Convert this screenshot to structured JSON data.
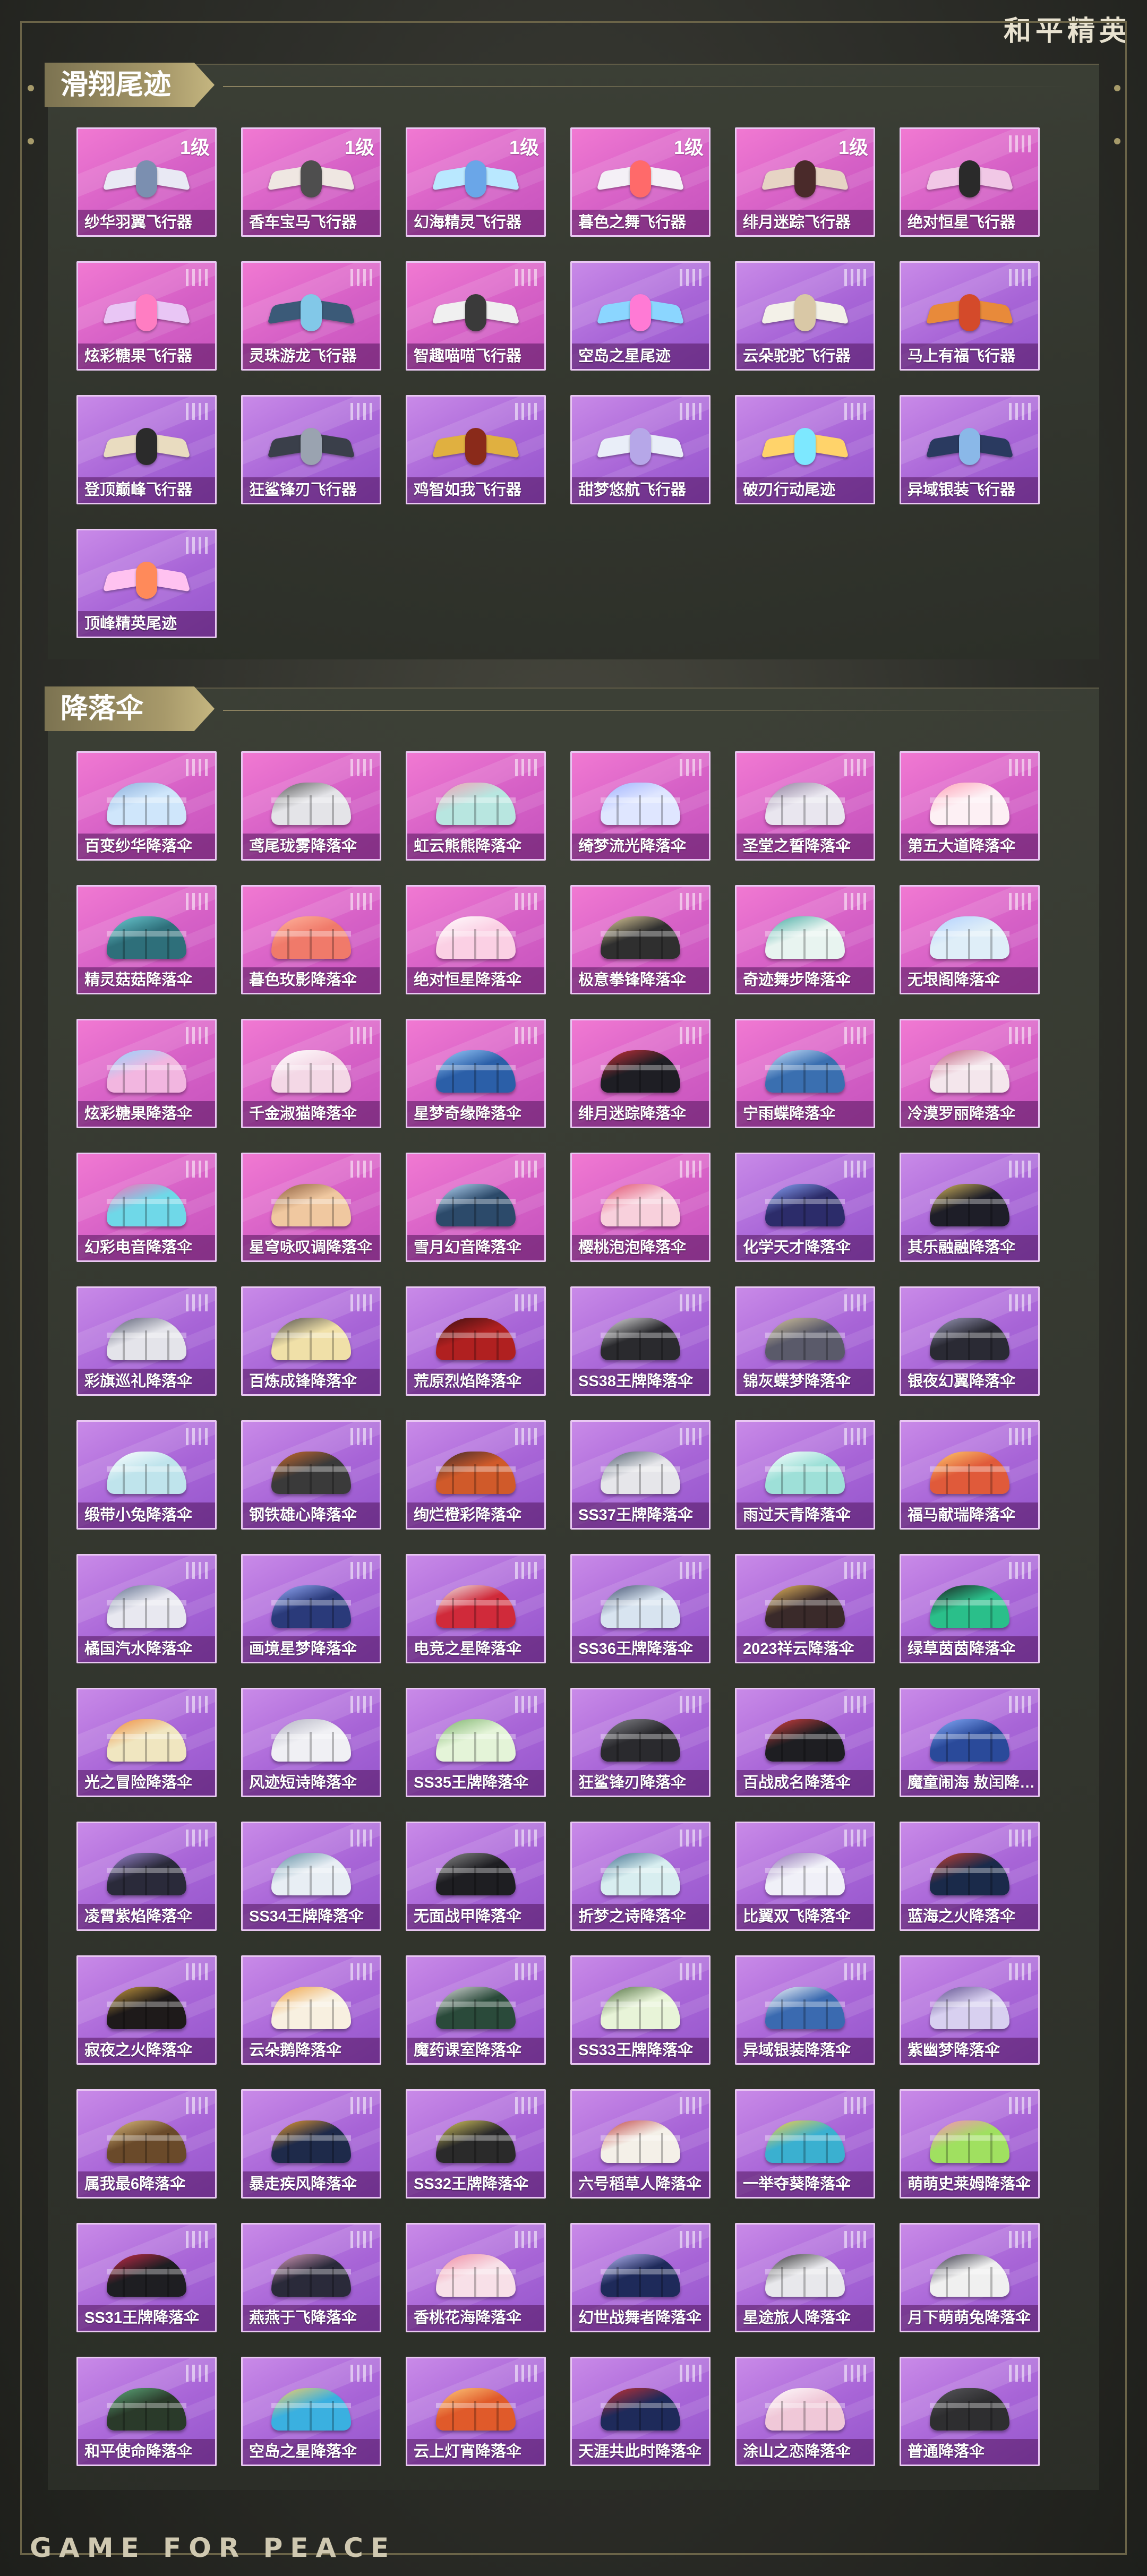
{
  "brand": {
    "logo_text": "和平精英",
    "footer_text": "GAME FOR PEACE"
  },
  "sections": [
    {
      "title": "滑翔尾迹",
      "items": [
        {
          "name": "纱华羽翼飞行器",
          "level": "1级",
          "style": "pink",
          "color": "#e9e9f4",
          "accent": "#7b8fb0"
        },
        {
          "name": "香车宝马飞行器",
          "level": "1级",
          "style": "pink",
          "color": "#efe7e2",
          "accent": "#4e4e4e"
        },
        {
          "name": "幻海精灵飞行器",
          "level": "1级",
          "style": "pink",
          "color": "#b9e8ff",
          "accent": "#6aa6e8"
        },
        {
          "name": "暮色之舞飞行器",
          "level": "1级",
          "style": "pink",
          "color": "#f4f0f6",
          "accent": "#ff6a6a"
        },
        {
          "name": "绯月迷踪飞行器",
          "level": "1级",
          "style": "pink",
          "color": "#e6d4c4",
          "accent": "#4a2a2a"
        },
        {
          "name": "绝对恒星飞行器",
          "level": "",
          "style": "pink",
          "color": "#f1c8e6",
          "accent": "#2a2a2a"
        },
        {
          "name": "炫彩糖果飞行器",
          "level": "",
          "style": "pink",
          "color": "#e9c6f5",
          "accent": "#ff7dc2"
        },
        {
          "name": "灵珠游龙飞行器",
          "level": "",
          "style": "pink",
          "color": "#3b5a78",
          "accent": "#82c8e8"
        },
        {
          "name": "智趣喵喵飞行器",
          "level": "",
          "style": "pink",
          "color": "#f0f0f0",
          "accent": "#3a3a3a"
        },
        {
          "name": "空岛之星尾迹",
          "level": "",
          "style": "purple",
          "color": "#8bd6ff",
          "accent": "#ff7ad5"
        },
        {
          "name": "云朵驼驼飞行器",
          "level": "",
          "style": "purple",
          "color": "#f3f1e8",
          "accent": "#d9c8a6"
        },
        {
          "name": "马上有福飞行器",
          "level": "",
          "style": "purple",
          "color": "#e88a3a",
          "accent": "#d44a2a"
        },
        {
          "name": "登顶巅峰飞行器",
          "level": "",
          "style": "purple",
          "color": "#e9dcc0",
          "accent": "#2b2b2b"
        },
        {
          "name": "狂鲨锋刃飞行器",
          "level": "",
          "style": "purple",
          "color": "#3a3f4a",
          "accent": "#9aa3b0"
        },
        {
          "name": "鸡智如我飞行器",
          "level": "",
          "style": "purple",
          "color": "#e0b040",
          "accent": "#8a2a1a"
        },
        {
          "name": "甜梦悠航飞行器",
          "level": "",
          "style": "purple",
          "color": "#e9eef8",
          "accent": "#b6a7e8"
        },
        {
          "name": "破刃行动尾迹",
          "level": "",
          "style": "purple",
          "color": "#ffd36a",
          "accent": "#7de8ff"
        },
        {
          "name": "异域银装飞行器",
          "level": "",
          "style": "purple",
          "color": "#2a3a60",
          "accent": "#8ab8e8"
        },
        {
          "name": "顶峰精英尾迹",
          "level": "",
          "style": "purple",
          "color": "#ffc2f0",
          "accent": "#ff8a5a"
        }
      ]
    },
    {
      "title": "降落伞",
      "items": [
        {
          "name": "百变纱华降落伞",
          "level": "",
          "style": "pink",
          "color": "#cfe6fb",
          "accent": "#8aaedb"
        },
        {
          "name": "鸢尾珑雾降落伞",
          "level": "",
          "style": "pink",
          "color": "#e4e4e8",
          "accent": "#555555"
        },
        {
          "name": "虹云熊熊降落伞",
          "level": "",
          "style": "pink",
          "color": "#b8e6e0",
          "accent": "#f4a0b4"
        },
        {
          "name": "绮梦流光降落伞",
          "level": "",
          "style": "pink",
          "color": "#dfe6ff",
          "accent": "#9fb2ff"
        },
        {
          "name": "圣堂之誓降落伞",
          "level": "",
          "style": "pink",
          "color": "#e9e6ef",
          "accent": "#8b7a9a"
        },
        {
          "name": "第五大道降落伞",
          "level": "",
          "style": "pink",
          "color": "#fdf0f4",
          "accent": "#ff9fb5"
        },
        {
          "name": "精灵菇菇降落伞",
          "level": "",
          "style": "pink",
          "color": "#2e6f7a",
          "accent": "#6fd0d8"
        },
        {
          "name": "暮色玫影降落伞",
          "level": "",
          "style": "pink",
          "color": "#f07a6a",
          "accent": "#ffb7a0"
        },
        {
          "name": "绝对恒星降落伞",
          "level": "",
          "style": "pink",
          "color": "#fbd0e4",
          "accent": "#ffffff"
        },
        {
          "name": "极意拳锋降落伞",
          "level": "",
          "style": "pink",
          "color": "#2f2f2f",
          "accent": "#e9d6a0"
        },
        {
          "name": "奇迹舞步降落伞",
          "level": "",
          "style": "pink",
          "color": "#e8f4f0",
          "accent": "#3fa8a0"
        },
        {
          "name": "无垠阁降落伞",
          "level": "",
          "style": "pink",
          "color": "#dfeef8",
          "accent": "#b0d0ff"
        },
        {
          "name": "炫彩糖果降落伞",
          "level": "",
          "style": "pink",
          "color": "#f2b6e0",
          "accent": "#8ed6ff"
        },
        {
          "name": "千金淑猫降落伞",
          "level": "",
          "style": "pink",
          "color": "#f4d8e6",
          "accent": "#ffffff"
        },
        {
          "name": "星梦奇缘降落伞",
          "level": "",
          "style": "pink",
          "color": "#2b5fa8",
          "accent": "#9fd0ff"
        },
        {
          "name": "绯月迷踪降落伞",
          "level": "",
          "style": "pink",
          "color": "#1e1e24",
          "accent": "#d2303a"
        },
        {
          "name": "宁雨蝶降落伞",
          "level": "",
          "style": "pink",
          "color": "#3a6fb0",
          "accent": "#cfe6ff"
        },
        {
          "name": "冷漠罗丽降落伞",
          "level": "",
          "style": "pink",
          "color": "#f4e6ec",
          "accent": "#c05a7a"
        },
        {
          "name": "幻彩电音降落伞",
          "level": "",
          "style": "pink",
          "color": "#6fd8e8",
          "accent": "#ff6ab8"
        },
        {
          "name": "星穹咏叹调降落伞",
          "level": "",
          "style": "pink",
          "color": "#f0c8a0",
          "accent": "#8a5a3a"
        },
        {
          "name": "雪月幻音降落伞",
          "level": "",
          "style": "pink",
          "color": "#2c4a6a",
          "accent": "#bfe0ff"
        },
        {
          "name": "樱桃泡泡降落伞",
          "level": "",
          "style": "pink",
          "color": "#f8d0dc",
          "accent": "#e04a6a"
        },
        {
          "name": "化学天才降落伞",
          "level": "",
          "style": "purple",
          "color": "#2c2c6a",
          "accent": "#8fa8ff"
        },
        {
          "name": "其乐融融降落伞",
          "level": "",
          "style": "purple",
          "color": "#1e1e28",
          "accent": "#e0c060"
        },
        {
          "name": "彩旗巡礼降落伞",
          "level": "",
          "style": "purple",
          "color": "#e4e4ea",
          "accent": "#555a70"
        },
        {
          "name": "百炼成锋降落伞",
          "level": "",
          "style": "purple",
          "color": "#f0e0a8",
          "accent": "#4a4a4a"
        },
        {
          "name": "荒原烈焰降落伞",
          "level": "",
          "style": "purple",
          "color": "#b02020",
          "accent": "#3a1010"
        },
        {
          "name": "SS38王牌降落伞",
          "level": "",
          "style": "purple",
          "color": "#2a2a2e",
          "accent": "#e8e8e8"
        },
        {
          "name": "锦灰蝶梦降落伞",
          "level": "",
          "style": "purple",
          "color": "#5a5a6a",
          "accent": "#d8c8a0"
        },
        {
          "name": "银夜幻翼降落伞",
          "level": "",
          "style": "purple",
          "color": "#2a2a34",
          "accent": "#a0a0c0"
        },
        {
          "name": "缎带小兔降落伞",
          "level": "",
          "style": "purple",
          "color": "#bfe4ec",
          "accent": "#ffffff"
        },
        {
          "name": "钢铁雄心降落伞",
          "level": "",
          "style": "purple",
          "color": "#3a3a3a",
          "accent": "#d06a2a"
        },
        {
          "name": "绚烂橙彩降落伞",
          "level": "",
          "style": "purple",
          "color": "#d05a2a",
          "accent": "#3a2a2a"
        },
        {
          "name": "SS37王牌降落伞",
          "level": "",
          "style": "purple",
          "color": "#e6e6ea",
          "accent": "#4a5a6a"
        },
        {
          "name": "雨过天青降落伞",
          "level": "",
          "style": "purple",
          "color": "#9ee0d8",
          "accent": "#ffffff"
        },
        {
          "name": "福马献瑞降落伞",
          "level": "",
          "style": "purple",
          "color": "#e05a3a",
          "accent": "#ffd070"
        },
        {
          "name": "橘国汽水降落伞",
          "level": "",
          "style": "purple",
          "color": "#e8e8f0",
          "accent": "#5a6a8a"
        },
        {
          "name": "画境星梦降落伞",
          "level": "",
          "style": "purple",
          "color": "#2a3a7a",
          "accent": "#9ab0ff"
        },
        {
          "name": "电竞之星降落伞",
          "level": "",
          "style": "purple",
          "color": "#d02a3a",
          "accent": "#f0f0f0"
        },
        {
          "name": "SS36王牌降落伞",
          "level": "",
          "style": "purple",
          "color": "#d8e4f0",
          "accent": "#3a4a6a"
        },
        {
          "name": "2023祥云降落伞",
          "level": "",
          "style": "purple",
          "color": "#3a2a2a",
          "accent": "#f0c060"
        },
        {
          "name": "绿草茵茵降落伞",
          "level": "",
          "style": "purple",
          "color": "#2abf8a",
          "accent": "#1a1a1a"
        },
        {
          "name": "光之冒险降落伞",
          "level": "",
          "style": "purple",
          "color": "#f0e6c0",
          "accent": "#f08a3a"
        },
        {
          "name": "风迹短诗降落伞",
          "level": "",
          "style": "purple",
          "color": "#f0f0f4",
          "accent": "#b0b0c0"
        },
        {
          "name": "SS35王牌降落伞",
          "level": "",
          "style": "purple",
          "color": "#e4f4d8",
          "accent": "#7ab06a"
        },
        {
          "name": "狂鲨锋刃降落伞",
          "level": "",
          "style": "purple",
          "color": "#2a2a2e",
          "accent": "#8a8a90"
        },
        {
          "name": "百战成名降落伞",
          "level": "",
          "style": "purple",
          "color": "#1e1e22",
          "accent": "#e04040"
        },
        {
          "name": "魔童闹海 敖闰降落伞",
          "level": "",
          "style": "purple",
          "color": "#2a4a9a",
          "accent": "#8ab0ff"
        },
        {
          "name": "凌霄紫焰降落伞",
          "level": "",
          "style": "purple",
          "color": "#2a2a3a",
          "accent": "#a08ad8"
        },
        {
          "name": "SS34王牌降落伞",
          "level": "",
          "style": "purple",
          "color": "#e8eef4",
          "accent": "#5a8aa0"
        },
        {
          "name": "无面战甲降落伞",
          "level": "",
          "style": "purple",
          "color": "#1e1e22",
          "accent": "#909090"
        },
        {
          "name": "折梦之诗降落伞",
          "level": "",
          "style": "purple",
          "color": "#d8eef0",
          "accent": "#3a6a8a"
        },
        {
          "name": "比翼双飞降落伞",
          "level": "",
          "style": "purple",
          "color": "#f0f0f8",
          "accent": "#8a6ab0"
        },
        {
          "name": "蓝海之火降落伞",
          "level": "",
          "style": "purple",
          "color": "#1a2a4a",
          "accent": "#d04030"
        },
        {
          "name": "寂夜之火降落伞",
          "level": "",
          "style": "purple",
          "color": "#1e1a1a",
          "accent": "#d0a040"
        },
        {
          "name": "云朵鹅降落伞",
          "level": "",
          "style": "purple",
          "color": "#f8f0e0",
          "accent": "#f0a040"
        },
        {
          "name": "魔药课室降落伞",
          "level": "",
          "style": "purple",
          "color": "#2a4a3a",
          "accent": "#e0e0e0"
        },
        {
          "name": "SS33王牌降落伞",
          "level": "",
          "style": "purple",
          "color": "#e8f4d8",
          "accent": "#4a6a3a"
        },
        {
          "name": "异域银装降落伞",
          "level": "",
          "style": "purple",
          "color": "#3a6ab0",
          "accent": "#ffffff"
        },
        {
          "name": "紫幽梦降落伞",
          "level": "",
          "style": "purple",
          "color": "#d8d0f0",
          "accent": "#5a4a8a"
        },
        {
          "name": "属我最6降落伞",
          "level": "",
          "style": "purple",
          "color": "#6a4a2a",
          "accent": "#e0c080"
        },
        {
          "name": "暴走疾风降落伞",
          "level": "",
          "style": "purple",
          "color": "#1e2a4a",
          "accent": "#f0a030"
        },
        {
          "name": "SS32王牌降落伞",
          "level": "",
          "style": "purple",
          "color": "#2a2a2a",
          "accent": "#e0d060"
        },
        {
          "name": "六号稻草人降落伞",
          "level": "",
          "style": "purple",
          "color": "#f4f0e8",
          "accent": "#c04040"
        },
        {
          "name": "一举夺葵降落伞",
          "level": "",
          "style": "purple",
          "color": "#3ab0d0",
          "accent": "#ffd040"
        },
        {
          "name": "萌萌史莱姆降落伞",
          "level": "",
          "style": "purple",
          "color": "#a0e060",
          "accent": "#ff8ac0"
        },
        {
          "name": "SS31王牌降落伞",
          "level": "",
          "style": "purple",
          "color": "#1e1e22",
          "accent": "#d02a4a"
        },
        {
          "name": "燕燕于飞降落伞",
          "level": "",
          "style": "purple",
          "color": "#2a2a3a",
          "accent": "#e0a0c0"
        },
        {
          "name": "香桃花海降落伞",
          "level": "",
          "style": "purple",
          "color": "#f8e0e8",
          "accent": "#f08aa0"
        },
        {
          "name": "幻世战舞者降落伞",
          "level": "",
          "style": "purple",
          "color": "#1e2a5a",
          "accent": "#c0c0ff"
        },
        {
          "name": "星途旅人降落伞",
          "level": "",
          "style": "purple",
          "color": "#e8e8ec",
          "accent": "#2a2a2a"
        },
        {
          "name": "月下萌萌兔降落伞",
          "level": "",
          "style": "purple",
          "color": "#f0f0f0",
          "accent": "#2a2a3a"
        },
        {
          "name": "和平使命降落伞",
          "level": "",
          "style": "purple",
          "color": "#2a3a2a",
          "accent": "#60b080"
        },
        {
          "name": "空岛之星降落伞",
          "level": "",
          "style": "purple",
          "color": "#3ab0e0",
          "accent": "#ffd060"
        },
        {
          "name": "云上灯宵降落伞",
          "level": "",
          "style": "purple",
          "color": "#e05a2a",
          "accent": "#ffd080"
        },
        {
          "name": "天涯共此时降落伞",
          "level": "",
          "style": "purple",
          "color": "#1e2a5a",
          "accent": "#d03030"
        },
        {
          "name": "涂山之恋降落伞",
          "level": "",
          "style": "purple",
          "color": "#f0c8d8",
          "accent": "#ffffff"
        },
        {
          "name": "普通降落伞",
          "level": "",
          "style": "purple",
          "color": "#2e2e30",
          "accent": "#5a5a5e"
        }
      ]
    }
  ]
}
